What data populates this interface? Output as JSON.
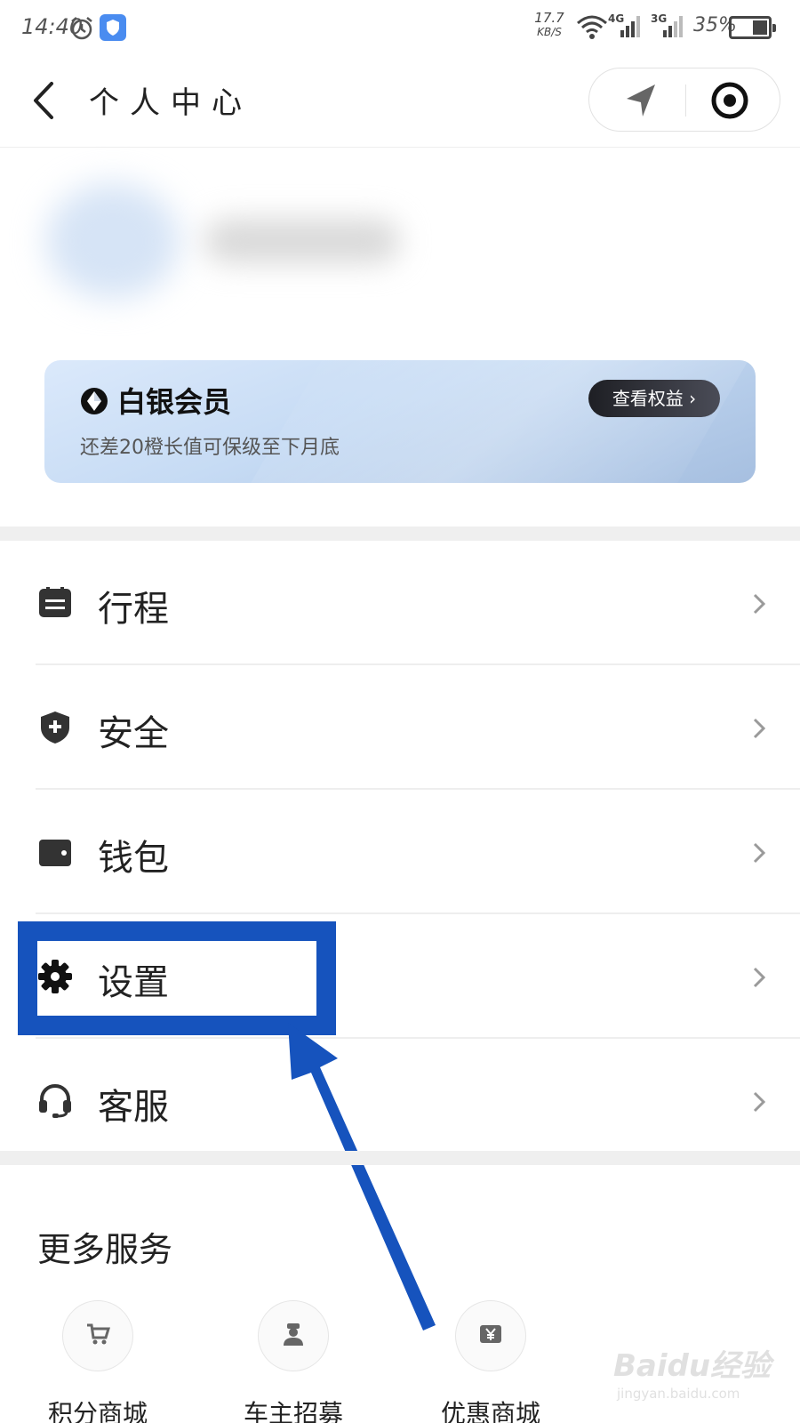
{
  "status_bar": {
    "time": "14:40",
    "net_speed_value": "17.7",
    "net_speed_unit": "KB/S",
    "sig1_label": "4G",
    "sig2_label": "3G",
    "battery_pct": "35%"
  },
  "nav": {
    "title": "个人中心"
  },
  "member": {
    "title": "白银会员",
    "subtitle": "还差20橙长值可保级至下月底",
    "benefit_button": "查看权益 ›"
  },
  "menu": {
    "items": [
      {
        "label": "行程",
        "icon": "itinerary-icon"
      },
      {
        "label": "安全",
        "icon": "shield-plus-icon"
      },
      {
        "label": "钱包",
        "icon": "wallet-icon"
      },
      {
        "label": "设置",
        "icon": "gear-icon"
      },
      {
        "label": "客服",
        "icon": "headset-icon"
      }
    ]
  },
  "services": {
    "title": "更多服务",
    "items": [
      {
        "label": "积分商城",
        "icon": "cart-icon"
      },
      {
        "label": "车主招募",
        "icon": "driver-icon"
      },
      {
        "label": "优惠商城",
        "icon": "yen-coupon-icon"
      }
    ]
  },
  "watermark": {
    "brand": "Baidu经验",
    "url": "jingyan.baidu.com"
  },
  "colors": {
    "annotation_blue": "#1653bd",
    "icon_dark": "#333333",
    "chevron": "#9a9a9a"
  }
}
